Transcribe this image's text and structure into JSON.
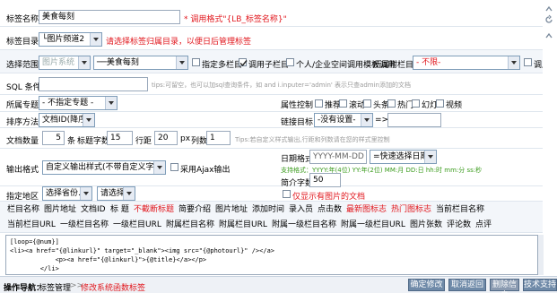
{
  "row1": {
    "label": "标签名称",
    "value": "美食每刻",
    "hint": "* 调用格式\"{LB_标签名称}\""
  },
  "row2": {
    "label": "标签目录",
    "dir_select": "└图片频道2",
    "hint": "请选择标签归属目录，以便日后管理标签"
  },
  "row3": {
    "label": "选择范围",
    "sel_disabled": "图片系统",
    "sel_cat": "──美食每刻",
    "cb_multi": "指定多栏目",
    "cb_subcol": "调用子栏目",
    "cb_space": "个人/企业空间调用模板调用",
    "label_parent": "所属附栏目",
    "sel_parent": "- 不限-",
    "cb_subcol2": "调用子栏"
  },
  "row4": {
    "label": "SQL 条件",
    "tip": "tips:可留空，也可以加sql查询条件，如 and i.inputer='admin' 表示只查admin添加的文档"
  },
  "row5": {
    "label": "所属专题",
    "sel_topic": "- 不指定专题 -",
    "label_attr": "属性控制",
    "attrs": [
      "推荐",
      "滚动",
      "头条",
      "热门",
      "幻灯",
      "视频"
    ]
  },
  "row6": {
    "label": "排序方法",
    "sel_order": "文档ID(降序)",
    "label_target": "链接目标",
    "sel_target": "-没有设置-",
    "arrow": "=>"
  },
  "row7": {
    "label": "文档数量",
    "num": "5",
    "unit_num": "条",
    "label_title": "标题字数",
    "title_len": "15",
    "label_row": "行距",
    "row_h": "20",
    "unit_px": "px",
    "label_cols": "列数",
    "cols": "1",
    "tip": "Tips:若自定义样式输出,行距和列数请在您的样式里控制"
  },
  "row8": {
    "label": "输出格式",
    "sel_output": "自定义输出样式(不带自定义字段)",
    "cb_ajax": "采用Ajax输出",
    "label_date": "日期格式",
    "date_value": "YYYY-MM-DD",
    "sel_date": "=快速选择日期=",
    "date_tip": "支持格式：YYYY:年(4位) YY:年(2位) MM:月 DD:日 hh:时 mm:分 ss:秒",
    "label_intro": "简介字数",
    "intro": "50"
  },
  "row9": {
    "label": "指定地区",
    "sel_prov": "选择省份...",
    "sel_city": "请选择",
    "cb_pic": "仅显示有图片的文档"
  },
  "fields1": [
    "栏目名称",
    "图片地址",
    "文档ID",
    "标 题",
    "不截断标题",
    "简要介绍",
    "图片地址",
    "添加时间",
    "录入员",
    "点击数",
    "最新图标志",
    "热门图标志",
    "当前栏目名称"
  ],
  "fields1_red": [
    false,
    false,
    false,
    false,
    true,
    false,
    false,
    false,
    false,
    false,
    true,
    true,
    false
  ],
  "fields2": [
    "当前栏目URL",
    "一级栏目名称",
    "一级栏目URL",
    "附属栏目名称",
    "附属栏目URL",
    "附属一级栏目名称",
    "附属一级栏目URL",
    "图片张数",
    "评论数",
    "点评"
  ],
  "template": "[loop={@num}]\n<li><a href=\"{@linkurl}\" target=\"_blank\"><img src=\"{@photourl}\" /></a>\n            <p><a href=\"{@linkurl}\">{@title}</a></p>\n        </li>",
  "nav": {
    "prefix": "操作导航：",
    "path": "标签管理",
    "sep": ">>",
    "current": "修改系统函数标签"
  },
  "buttons": [
    "确定修改",
    "取消返回",
    "删除信息",
    "技术支持"
  ]
}
